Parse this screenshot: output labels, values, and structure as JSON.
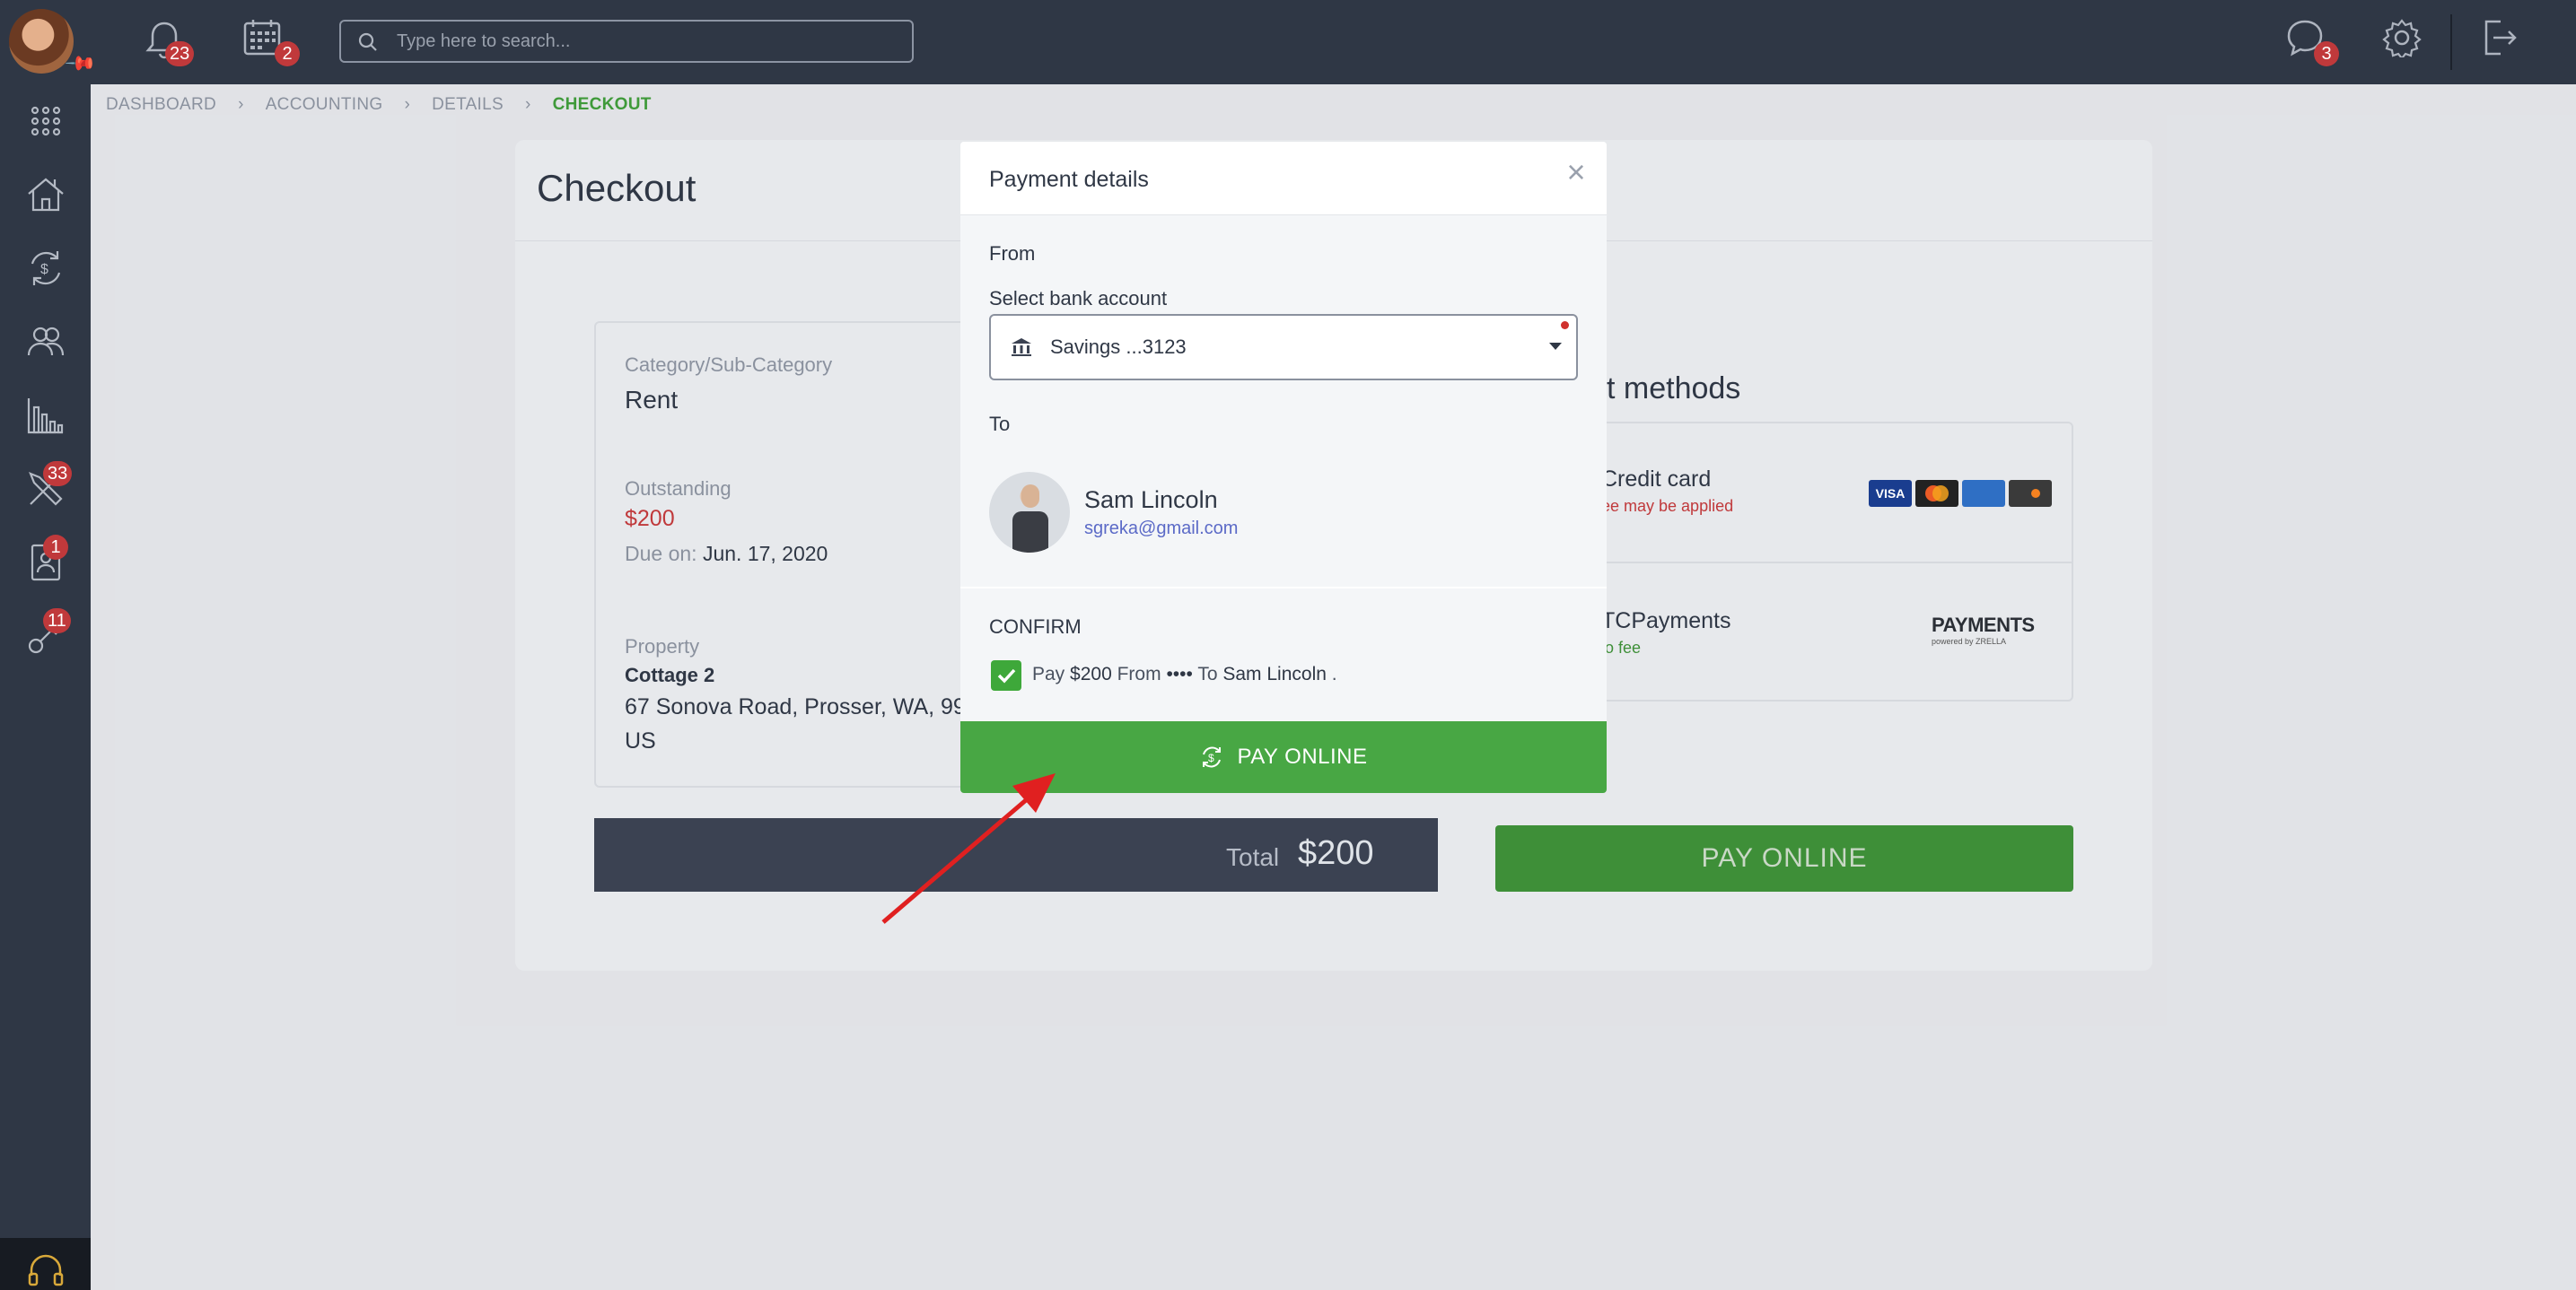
{
  "topbar": {
    "notifications_count": "23",
    "calendar_count": "2",
    "search_placeholder": "Type here to search...",
    "messages_count": "3"
  },
  "sidebar": {
    "items": [
      {
        "icon": "apps-grid-icon",
        "badge": ""
      },
      {
        "icon": "house-icon",
        "badge": ""
      },
      {
        "icon": "money-exchange-icon",
        "badge": ""
      },
      {
        "icon": "people-icon",
        "badge": ""
      },
      {
        "icon": "bar-chart-icon",
        "badge": ""
      },
      {
        "icon": "tools-icon",
        "badge": "33"
      },
      {
        "icon": "tenant-card-icon",
        "badge": "1"
      },
      {
        "icon": "key-icon",
        "badge": "11"
      }
    ],
    "support_icon": "headset-icon"
  },
  "breadcrumb": [
    "DASHBOARD",
    "ACCOUNTING",
    "DETAILS",
    "CHECKOUT"
  ],
  "page": {
    "title": "Checkout",
    "category_label": "Category/Sub-Category",
    "category_value": "Rent",
    "outstanding_label": "Outstanding",
    "outstanding_value": "$200",
    "due_label": "Due on:",
    "due_value": "Jun. 17, 2020",
    "property_label": "Property",
    "property_name": "Cottage 2",
    "property_address_1": "67 Sonova Road, Prosser, WA, 99",
    "property_address_2": "US",
    "total_label": "Total",
    "total_value": "$200",
    "methods_title": "t methods",
    "method_1_name": "Credit card",
    "method_1_note": "ee may be applied",
    "method_2_name": "TCPayments",
    "method_2_note": "lo fee",
    "payments_logo_text": "PAYMENTS",
    "payments_logo_sub": "powered by ZRELLA",
    "pay_button": "PAY ONLINE",
    "colors": {
      "accent_green": "#48a744",
      "due_red": "#c0393b",
      "sidebar": "#2f3745"
    }
  },
  "modal": {
    "title": "Payment details",
    "from_label": "From",
    "select_label": "Select bank account",
    "selected_account": "Savings ...3123",
    "to_label": "To",
    "recipient_name": "Sam Lincoln",
    "recipient_email": "sgreka@gmail.com",
    "confirm_label": "CONFIRM",
    "confirm_pay": "Pay",
    "confirm_amount": "$200",
    "confirm_from": "From",
    "confirm_dots": "••••",
    "confirm_to": "To",
    "confirm_recipient": "Sam Lincoln",
    "confirm_period": ".",
    "pay_button": "PAY ONLINE",
    "confirm_checked": true
  }
}
